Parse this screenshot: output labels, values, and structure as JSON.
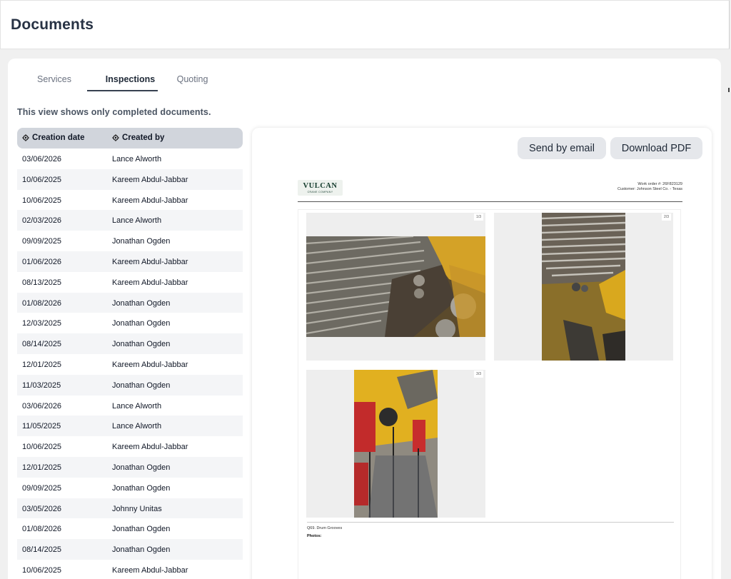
{
  "header": {
    "title": "Documents"
  },
  "tabs": [
    {
      "label": "Services",
      "active": false
    },
    {
      "label": "Inspections",
      "active": true
    },
    {
      "label": "Quoting",
      "active": false
    }
  ],
  "note": "This view shows only completed documents.",
  "table": {
    "columns": [
      "Creation date",
      "Created by"
    ],
    "rows": [
      [
        "03/06/2026",
        "Lance Alworth"
      ],
      [
        "10/06/2025",
        "Kareem Abdul-Jabbar"
      ],
      [
        "10/06/2025",
        "Kareem Abdul-Jabbar"
      ],
      [
        "02/03/2026",
        "Lance Alworth"
      ],
      [
        "09/09/2025",
        "Jonathan Ogden"
      ],
      [
        "01/06/2026",
        "Kareem Abdul-Jabbar"
      ],
      [
        "08/13/2025",
        "Kareem Abdul-Jabbar"
      ],
      [
        "01/08/2026",
        "Jonathan Ogden"
      ],
      [
        "12/03/2025",
        "Jonathan Ogden"
      ],
      [
        "08/14/2025",
        "Jonathan Ogden"
      ],
      [
        "12/01/2025",
        "Kareem Abdul-Jabbar"
      ],
      [
        "11/03/2025",
        "Jonathan Ogden"
      ],
      [
        "03/06/2026",
        "Lance Alworth"
      ],
      [
        "11/05/2025",
        "Lance Alworth"
      ],
      [
        "10/06/2025",
        "Kareem Abdul-Jabbar"
      ],
      [
        "12/01/2025",
        "Jonathan Ogden"
      ],
      [
        "09/09/2025",
        "Jonathan Ogden"
      ],
      [
        "03/05/2026",
        "Johnny Unitas"
      ],
      [
        "01/08/2026",
        "Jonathan Ogden"
      ],
      [
        "08/14/2025",
        "Jonathan Ogden"
      ],
      [
        "10/06/2025",
        "Kareem Abdul-Jabbar"
      ]
    ]
  },
  "preview": {
    "send_email_label": "Send by email",
    "download_label": "Download PDF",
    "document": {
      "logo_text": "VULCAN",
      "logo_subtext": "CRANE COMPANY",
      "work_order": "Work order #: 26F823129",
      "customer": "Customer: Johnson Steel Co. - Texas",
      "photo_counters": [
        "1/3",
        "2/3",
        "3/3"
      ],
      "question": "Q69. Drum Grooves",
      "photos_label": "Photos:"
    }
  },
  "colors": {
    "page_bg": "#f0f0f0",
    "table_header_bg": "#d1d5dc",
    "button_bg": "#e5e7eb",
    "logo_green": "#123a2b"
  },
  "icons": {
    "column_header": "gear-icon"
  }
}
